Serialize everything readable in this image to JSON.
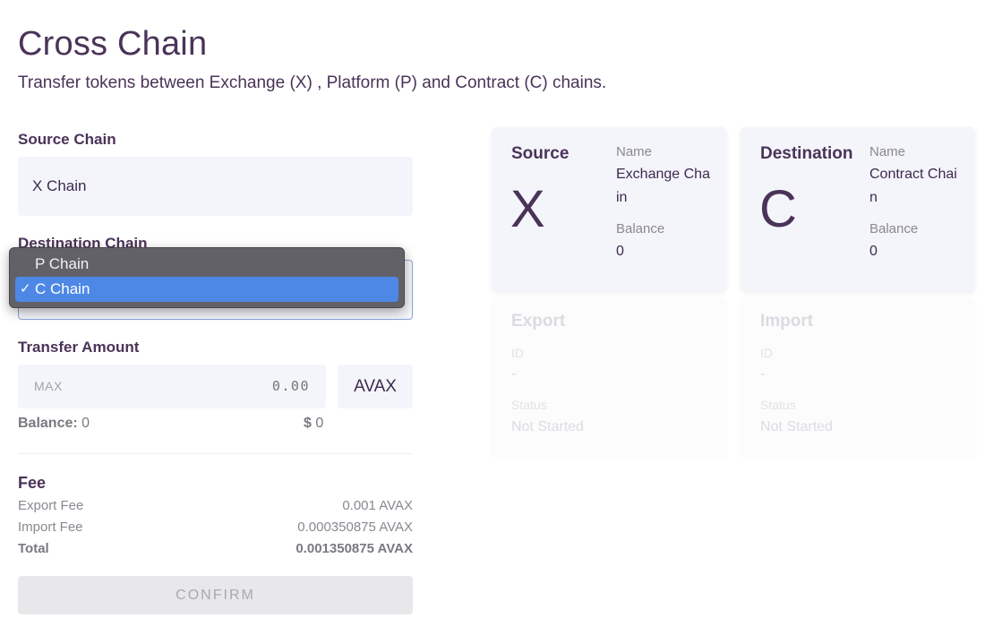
{
  "header": {
    "title": "Cross Chain",
    "subtitle": "Transfer tokens between Exchange (X) , Platform (P) and Contract (C) chains."
  },
  "form": {
    "source_chain": {
      "label": "Source Chain",
      "value": "X Chain"
    },
    "destination_chain": {
      "label": "Destination Chain",
      "selected": "C Chain",
      "options": [
        {
          "label": "P Chain",
          "selected": false
        },
        {
          "label": "C Chain",
          "selected": true
        }
      ],
      "check_icon": "✓"
    },
    "transfer_amount": {
      "label": "Transfer Amount",
      "max_label": "MAX",
      "placeholder": "0.00",
      "currency": "AVAX",
      "balance_label": "Balance:",
      "balance_value": "0",
      "usd_symbol": "$",
      "usd_value": "0"
    },
    "fee": {
      "title": "Fee",
      "rows": [
        {
          "label": "Export Fee",
          "value": "0.001 AVAX"
        },
        {
          "label": "Import Fee",
          "value": "0.000350875 AVAX"
        },
        {
          "label": "Total",
          "value": "0.001350875 AVAX"
        }
      ]
    },
    "confirm_label": "CONFIRM"
  },
  "cards": {
    "source": {
      "title": "Source",
      "letter": "X",
      "name_label": "Name",
      "name": "Exchange Chain",
      "balance_label": "Balance",
      "balance": "0"
    },
    "destination": {
      "title": "Destination",
      "letter": "C",
      "name_label": "Name",
      "name": "Contract Chain",
      "balance_label": "Balance",
      "balance": "0"
    },
    "export": {
      "title": "Export",
      "id_label": "ID",
      "id": "-",
      "status_label": "Status",
      "status": "Not Started"
    },
    "import": {
      "title": "Import",
      "id_label": "ID",
      "id": "-",
      "status_label": "Status",
      "status": "Not Started"
    }
  }
}
